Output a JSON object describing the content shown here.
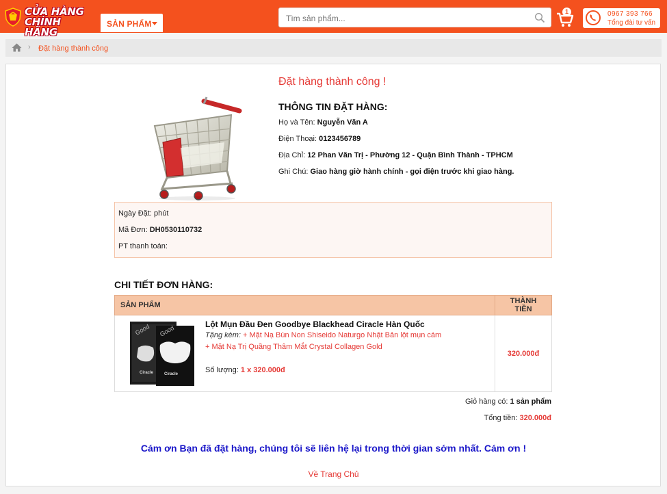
{
  "header": {
    "logo_line1": "CỬA HÀNG",
    "logo_line2": "CHÍNH HÃNG",
    "products_menu_label": "SẢN PHẨM",
    "search_placeholder": "Tìm sản phẩm...",
    "cart_count": "1",
    "hotline_number": "0967 393 766",
    "hotline_label": "Tổng đài tư vấn",
    "colors": {
      "brand": "#f4511e",
      "accent_red": "#e53935",
      "thanks_blue": "#1a17c9"
    }
  },
  "breadcrumb": {
    "home_icon": "home-icon",
    "current": "Đặt hàng thành công"
  },
  "order": {
    "success_message": "Đặt hàng thành công !",
    "info_title": "THÔNG TIN ĐẶT HÀNG:",
    "fields": [
      {
        "label": "Họ và Tên:",
        "value": "Nguyễn Văn A"
      },
      {
        "label": "Điện Thoại:",
        "value": "0123456789"
      },
      {
        "label": "Địa Chỉ:",
        "value": "12 Phan Văn Trị - Phường 12 - Quận Bình Thành - TPHCM"
      },
      {
        "label": "Ghi Chú:",
        "value": "Giao hàng giờ hành chính - gọi điện trước khi giao hàng."
      }
    ],
    "meta": [
      {
        "label": "Ngày Đặt:",
        "value": "phút"
      },
      {
        "label": "Mã Đơn:",
        "value": "DH0530110732"
      },
      {
        "label": "PT thanh toán:",
        "value": ""
      }
    ]
  },
  "details": {
    "title": "CHI TIẾT ĐƠN HÀNG:",
    "col_product": "SẢN PHẨM",
    "col_total": "THÀNH TIỀN",
    "items": [
      {
        "name": "Lột Mụn Đầu Đen Goodbye Blackhead Ciracle Hàn Quốc",
        "gift_label": "Tặng kèm:",
        "gift_1": "+ Mặt Nạ Bùn Non Shiseido Naturgo Nhật Bản lột mụn cám",
        "gift_2": "+ Mặt Nạ Trị Quầng Thâm Mắt Crystal Collagen Gold",
        "qty_label": "Số lượng:",
        "qty_value": "1 x 320.000đ",
        "total": "320.000đ"
      }
    ],
    "cart_count_label": "Giỏ hàng có:",
    "cart_count_value": "1 sản phẩm",
    "total_label": "Tổng tiền:",
    "total_value": "320.000đ"
  },
  "thanks": "Cám ơn Bạn đã đặt hàng, chúng tôi sẽ liên hệ lại trong thời gian sớm nhất. Cám ơn !",
  "home_link": "Về Trang Chủ"
}
